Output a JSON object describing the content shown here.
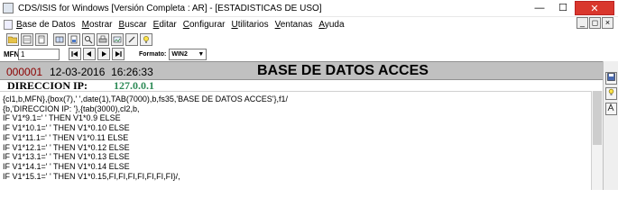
{
  "window": {
    "title": "CDS/ISIS for Windows [Versión Completa : AR] - [ESTADISTICAS DE USO]",
    "controls": [
      "—",
      "☐",
      "✕"
    ]
  },
  "menubar": {
    "items": [
      {
        "accel": "B",
        "rest": "ase de Datos"
      },
      {
        "accel": "M",
        "rest": "ostrar"
      },
      {
        "accel": "B",
        "rest": "uscar"
      },
      {
        "accel": "E",
        "rest": "ditar"
      },
      {
        "accel": "C",
        "rest": "onfigurar"
      },
      {
        "accel": "U",
        "rest": "tilitarios"
      },
      {
        "accel": "V",
        "rest": "entanas"
      },
      {
        "accel": "A",
        "rest": "yuda"
      }
    ],
    "mdi_controls": [
      "_",
      "◻",
      "×"
    ]
  },
  "toolbar": {
    "icons": [
      "open-folder-icon",
      "database-icon",
      "document-icon",
      "dictionary-icon",
      "report-icon",
      "search-icon",
      "print-icon",
      "image-icon",
      "edit-icon",
      "lightbulb-icon"
    ]
  },
  "navigation": {
    "mfn_label": "MFN",
    "mfn_value": "1",
    "buttons": [
      "first-record-icon",
      "previous-record-icon",
      "next-record-icon",
      "last-record-icon"
    ],
    "formato_label": "Formato:",
    "formato_value": "WIN2"
  },
  "record": {
    "mfn": "000001",
    "date": "12-03-2016",
    "time": "16:26:33",
    "title": "BASE DE DATOS ACCES",
    "direccion_label": "DIRECCION IP:",
    "direccion_value": "127.0.0.1"
  },
  "editor": {
    "lines": [
      "{cl1,b,MFN},{box(7),' ',date(1),TAB(7000),b,fs35,'BASE DE DATOS ACCES'},f1/",
      "{b,'DIRECCION IP: '},{tab(3000),cl2,b,",
      "IF V1*9.1=' ' THEN V1*0.9 ELSE",
      "IF V1*10.1=' ' THEN V1*0.10 ELSE",
      "IF V1*11.1=' ' THEN V1*0.11 ELSE",
      "IF V1*12.1=' ' THEN V1*0.12 ELSE",
      "IF V1*13.1=' ' THEN V1*0.13 ELSE",
      "IF V1*14.1=' ' THEN V1*0.14 ELSE",
      "IF V1*15.1=' ' THEN V1*0.15,FI,FI,FI,FI,FI,FI,FI}/,"
    ]
  },
  "side_tools": [
    "save-icon",
    "lightbulb-icon",
    "format-icon"
  ]
}
